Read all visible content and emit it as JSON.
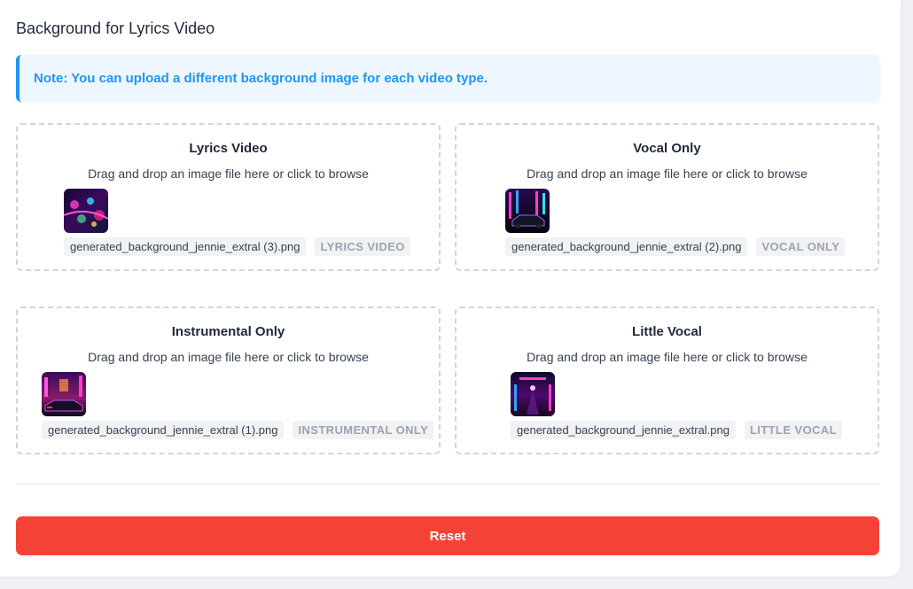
{
  "section": {
    "title": "Background for Lyrics Video"
  },
  "note": {
    "text": "Note: You can upload a different background image for each video type."
  },
  "dropzones": [
    {
      "title": "Lyrics Video",
      "hint": "Drag and drop an image file here or click to browse",
      "file_name": "generated_background_jennie_extral (3).png",
      "badge": "LYRICS VIDEO"
    },
    {
      "title": "Vocal Only",
      "hint": "Drag and drop an image file here or click to browse",
      "file_name": "generated_background_jennie_extral (2).png",
      "badge": "VOCAL ONLY"
    },
    {
      "title": "Instrumental Only",
      "hint": "Drag and drop an image file here or click to browse",
      "file_name": "generated_background_jennie_extral (1).png",
      "badge": "INSTRUMENTAL ONLY"
    },
    {
      "title": "Little Vocal",
      "hint": "Drag and drop an image file here or click to browse",
      "file_name": "generated_background_jennie_extral.png",
      "badge": "LITTLE VOCAL"
    }
  ],
  "actions": {
    "reset_label": "Reset"
  },
  "colors": {
    "accent": "#2196f3",
    "danger": "#f44336",
    "note_bg": "#eef6ff"
  }
}
